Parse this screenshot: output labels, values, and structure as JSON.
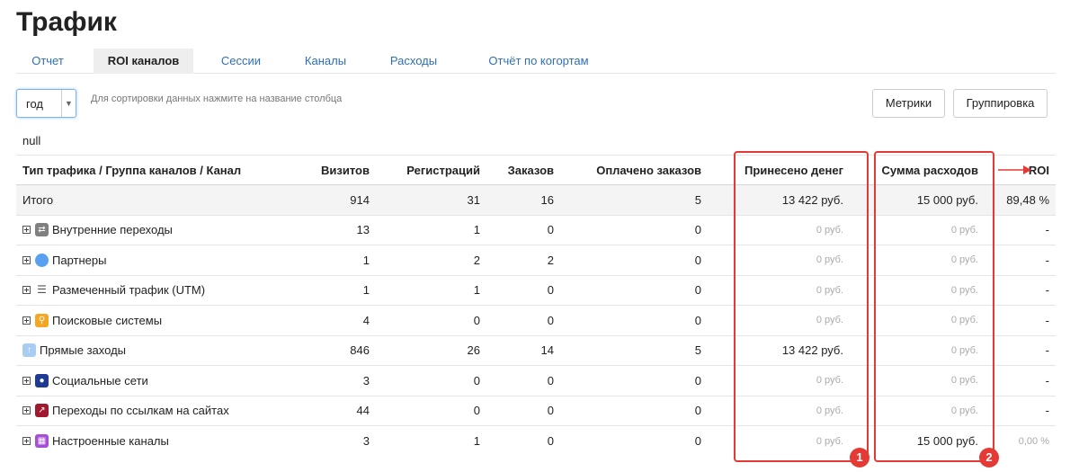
{
  "page": {
    "title": "Трафик"
  },
  "tabs": [
    {
      "label": "Отчет",
      "active": false
    },
    {
      "label": "ROI каналов",
      "active": true
    },
    {
      "label": "Сессии",
      "active": false
    },
    {
      "label": "Каналы",
      "active": false
    },
    {
      "label": "Расходы",
      "active": false
    },
    {
      "label": "Отчёт по когортам",
      "active": false
    }
  ],
  "toolbar": {
    "period_value": "год",
    "dropdown_arrow": "▼",
    "sort_hint": "Для сортировки данных нажмите на название столбца",
    "metrics_label": "Метрики",
    "grouping_label": "Группировка"
  },
  "null_label": "null",
  "table": {
    "headers": {
      "name": "Тип трафика / Группа каналов / Канал",
      "visits": "Визитов",
      "registrations": "Регистраций",
      "orders": "Заказов",
      "paid": "Оплачено заказов",
      "money": "Принесено денег",
      "cost": "Сумма расходов",
      "roi": "ROI"
    },
    "total": {
      "name": "Итого",
      "visits": "914",
      "registrations": "31",
      "orders": "16",
      "paid": "5",
      "money": "13 422 руб.",
      "cost": "15 000 руб.",
      "roi": "89,48 %"
    },
    "rows": [
      {
        "name": "Внутренние переходы",
        "icon": "arrows-swap-icon",
        "icon_color": "#808080",
        "expandable": true,
        "visits": "13",
        "registrations": "1",
        "orders": "0",
        "paid": "0",
        "money": "0 руб.",
        "cost": "0 руб.",
        "roi": "-"
      },
      {
        "name": "Партнеры",
        "icon": "chat-bubble-icon",
        "icon_color": "#5aa0f0",
        "expandable": true,
        "visits": "1",
        "registrations": "2",
        "orders": "2",
        "paid": "0",
        "money": "0 руб.",
        "cost": "0 руб.",
        "roi": "-"
      },
      {
        "name": "Размеченный трафик (UTM)",
        "icon": "list-icon",
        "icon_color": "#ffffff",
        "expandable": true,
        "visits": "1",
        "registrations": "1",
        "orders": "0",
        "paid": "0",
        "money": "0 руб.",
        "cost": "0 руб.",
        "roi": "-"
      },
      {
        "name": "Поисковые системы",
        "icon": "magnifier-icon",
        "icon_color": "#f5a623",
        "expandable": true,
        "visits": "4",
        "registrations": "0",
        "orders": "0",
        "paid": "0",
        "money": "0 руб.",
        "cost": "0 руб.",
        "roi": "-"
      },
      {
        "name": "Прямые заходы",
        "icon": "direct-arrow-icon",
        "icon_color": "#a9cdf2",
        "expandable": false,
        "visits": "846",
        "registrations": "26",
        "orders": "14",
        "paid": "5",
        "money": "13 422 руб.",
        "cost": "0 руб.",
        "roi": "-"
      },
      {
        "name": "Социальные сети",
        "icon": "person-icon",
        "icon_color": "#1f3a93",
        "expandable": true,
        "visits": "3",
        "registrations": "0",
        "orders": "0",
        "paid": "0",
        "money": "0 руб.",
        "cost": "0 руб.",
        "roi": "-"
      },
      {
        "name": "Переходы по ссылкам на сайтах",
        "icon": "external-link-icon",
        "icon_color": "#a0192e",
        "expandable": true,
        "visits": "44",
        "registrations": "0",
        "orders": "0",
        "paid": "0",
        "money": "0 руб.",
        "cost": "0 руб.",
        "roi": "-"
      },
      {
        "name": "Настроенные каналы",
        "icon": "grid-box-icon",
        "icon_color": "#a64fd6",
        "expandable": true,
        "visits": "3",
        "registrations": "1",
        "orders": "0",
        "paid": "0",
        "money": "0 руб.",
        "cost": "15 000 руб.",
        "roi": "0,00 %"
      }
    ]
  },
  "annotations": {
    "badge1": "1",
    "badge2": "2",
    "accent_color": "#e53935"
  }
}
